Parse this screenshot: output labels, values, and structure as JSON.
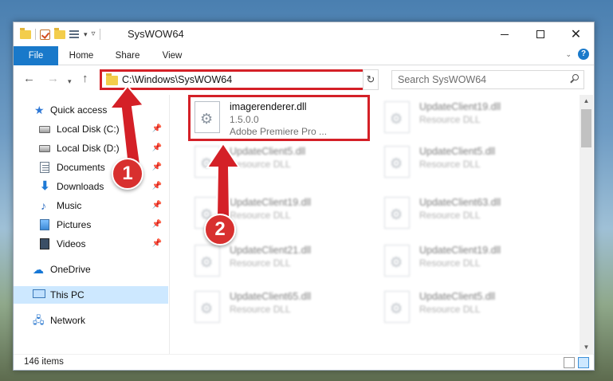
{
  "window": {
    "title": "SysWOW64"
  },
  "ribbon": {
    "tabs": [
      {
        "label": "File"
      },
      {
        "label": "Home"
      },
      {
        "label": "Share"
      },
      {
        "label": "View"
      }
    ],
    "help": "?"
  },
  "address_bar": {
    "path": "C:\\Windows\\SysWOW64"
  },
  "search": {
    "placeholder": "Search SysWOW64"
  },
  "sidebar": {
    "items": [
      {
        "label": "Quick access",
        "icon": "star-icon"
      },
      {
        "label": "Local Disk (C:)",
        "icon": "drive-icon",
        "pinned": true
      },
      {
        "label": "Local Disk (D:)",
        "icon": "drive-icon",
        "pinned": true
      },
      {
        "label": "Documents",
        "icon": "documents-icon",
        "pinned": true
      },
      {
        "label": "Downloads",
        "icon": "downloads-icon",
        "pinned": true
      },
      {
        "label": "Music",
        "icon": "music-icon",
        "pinned": true
      },
      {
        "label": "Pictures",
        "icon": "pictures-icon",
        "pinned": true
      },
      {
        "label": "Videos",
        "icon": "videos-icon",
        "pinned": true
      },
      {
        "label": "OneDrive",
        "icon": "onedrive-icon"
      },
      {
        "label": "This PC",
        "icon": "pc-icon",
        "selected": true
      },
      {
        "label": "Network",
        "icon": "network-icon"
      }
    ]
  },
  "files": {
    "highlighted": {
      "name": "imagerenderer.dll",
      "version": "1.5.0.0",
      "description": "Adobe Premiere Pro ..."
    },
    "others": [
      {
        "name": "UpdateClient19.dll",
        "type": "Resource DLL"
      },
      {
        "name": "UpdateClient5.dll",
        "type": "Resource DLL"
      },
      {
        "name": "UpdateClient5.dll",
        "type": "Resource DLL"
      },
      {
        "name": "UpdateClient19.dll",
        "type": "Resource DLL"
      },
      {
        "name": "UpdateClient63.dll",
        "type": "Resource DLL"
      },
      {
        "name": "UpdateClient21.dll",
        "type": "Resource DLL"
      },
      {
        "name": "UpdateClient19.dll",
        "type": "Resource DLL"
      },
      {
        "name": "UpdateClient65.dll",
        "type": "Resource DLL"
      },
      {
        "name": "UpdateClient5.dll",
        "type": "Resource DLL"
      }
    ]
  },
  "status": {
    "item_count": "146 items"
  },
  "annotations": {
    "step1": "1",
    "step2": "2",
    "color": "#d42027"
  }
}
